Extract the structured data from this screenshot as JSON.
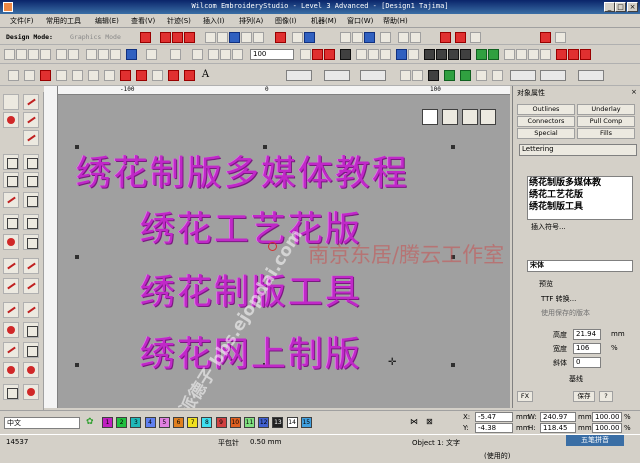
{
  "window": {
    "title": "Wilcom EmbroideryStudio - Level 3 Advanced - [Design1 Tajima]"
  },
  "menu": [
    "文件(F)",
    "常用的工具",
    "编辑(E)",
    "查看(V)",
    "针迹(S)",
    "插入(I)",
    "排列(A)",
    "图像(I)",
    "机器(M)",
    "窗口(W)",
    "帮助(H)"
  ],
  "toolbar": {
    "design_mode_label": "Design Mode:",
    "graphics_mode_label": "Graphics Mode",
    "zoom_value": "100"
  },
  "ruler": {
    "h_labels": [
      "-100",
      "0",
      "100"
    ]
  },
  "canvas": {
    "lines": [
      "绣花制版多媒体教程",
      "绣花工艺花版",
      "绣花制版工具",
      "绣花网上制版"
    ],
    "watermark": "南京东居/腾云工作室",
    "diagonal_watermark": "派德子 bbs.ejopdai.com"
  },
  "props": {
    "title": "对象属性",
    "tabs": [
      "Outlines",
      "Underlay",
      "Connectors",
      "Pull Comp",
      "Special",
      "Fills"
    ],
    "type_value": "Lettering",
    "text_lines": [
      "绣花制版多媒体教",
      "绣花工艺花版",
      "绣花制版工具"
    ],
    "insert_symbol": "插入符号...",
    "font_value": "宋体",
    "preview_label": "预览",
    "ttf_convert": "TTF 转换...",
    "use_saved": "使用保存的版本",
    "height_label": "高度",
    "height_value": "21.94",
    "height_unit": "mm",
    "width_label": "宽度",
    "width_value": "106",
    "width_unit": "%",
    "slant_label": "斜体",
    "slant_value": "0",
    "baseline_label": "基线",
    "fx_label": "FX",
    "save_label": "保存",
    "help_label": "?"
  },
  "colorbar": {
    "language_value": "中文",
    "swatches": [
      {
        "n": "1",
        "c": "#c020c0"
      },
      {
        "n": "2",
        "c": "#20c040"
      },
      {
        "n": "3",
        "c": "#20b8b8"
      },
      {
        "n": "4",
        "c": "#6080f0"
      },
      {
        "n": "5",
        "c": "#e080e0"
      },
      {
        "n": "6",
        "c": "#e08020"
      },
      {
        "n": "7",
        "c": "#f0e020"
      },
      {
        "n": "8",
        "c": "#40e0f0"
      },
      {
        "n": "9",
        "c": "#d04040"
      },
      {
        "n": "10",
        "c": "#e06020"
      },
      {
        "n": "11",
        "c": "#80e080"
      },
      {
        "n": "12",
        "c": "#4060d0"
      },
      {
        "n": "13",
        "c": "#202020"
      },
      {
        "n": "14",
        "c": "#ffffff"
      },
      {
        "n": "15",
        "c": "#40a0e0"
      }
    ],
    "x_label": "X:",
    "x_value": "-5.47",
    "y_label": "Y:",
    "y_value": "-4.38",
    "mm": "mm",
    "w_label": "W:",
    "w_value": "240.97",
    "h_label": "H:",
    "h_value": "118.45",
    "w_pct": "100.00",
    "h_pct": "100.00",
    "pct": "%"
  },
  "status": {
    "stitch_count": "14537",
    "stitch_type": "平包针",
    "length": "0.50 mm",
    "object_info": "Object 1: 文字",
    "used": "(使用的)",
    "ime": "五笔拼音"
  }
}
